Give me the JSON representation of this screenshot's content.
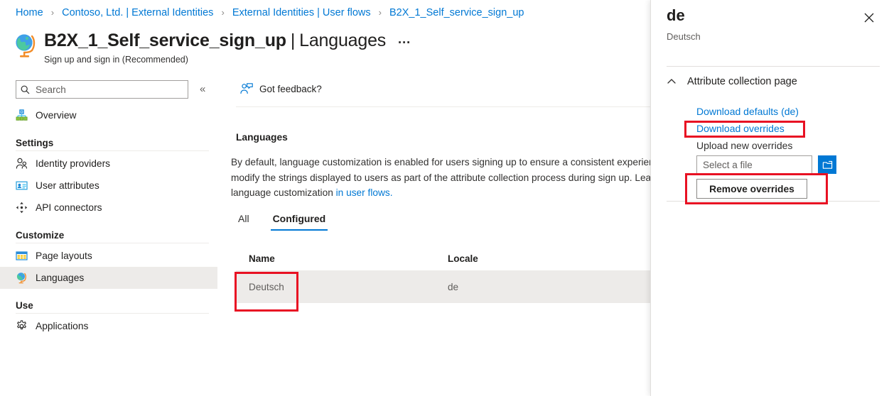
{
  "breadcrumb": {
    "items": [
      {
        "label": "Home"
      },
      {
        "label": "Contoso, Ltd. | External Identities"
      },
      {
        "label": "External Identities | User flows"
      },
      {
        "label": "B2X_1_Self_service_sign_up"
      }
    ],
    "separator": "›"
  },
  "header": {
    "title_main": "B2X_1_Self_service_sign_up",
    "title_sep": "|",
    "title_section": "Languages",
    "more_label": "…",
    "subtitle": "Sign up and sign in (Recommended)",
    "icon": "globe-icon"
  },
  "sidebar": {
    "search": {
      "placeholder": "Search",
      "value": "",
      "icon": "search-icon"
    },
    "collapse": {
      "label": "«",
      "icon": "chevron-double-left-icon"
    },
    "items": [
      {
        "label": "Overview",
        "icon": "hierarchy-icon",
        "selected": false
      },
      {
        "label": "Identity providers",
        "icon": "people-icon",
        "selected": false
      },
      {
        "label": "User attributes",
        "icon": "id-card-icon",
        "selected": false
      },
      {
        "label": "API connectors",
        "icon": "four-arrows-icon",
        "selected": false
      },
      {
        "label": "Page layouts",
        "icon": "table-icon",
        "selected": false
      },
      {
        "label": "Languages",
        "icon": "globe-icon",
        "selected": true
      },
      {
        "label": "Applications",
        "icon": "gear-icon",
        "selected": false
      }
    ],
    "sections": [
      {
        "label": "Settings"
      },
      {
        "label": "Customize"
      },
      {
        "label": "Use"
      }
    ]
  },
  "main": {
    "command_bar": {
      "feedback_label": "Got feedback?",
      "feedback_icon": "person-feedback-icon"
    },
    "section_title": "Languages",
    "description_text": "By default, language customization is enabled for users signing up to ensure a consistent experience. You can modify the strings displayed to users as part of the attribute collection process during sign up. Learn more about language customization",
    "description_link": "in user flows.",
    "tabs": [
      {
        "label": "All",
        "active": false
      },
      {
        "label": "Configured",
        "active": true
      }
    ],
    "table": {
      "columns": [
        "Name",
        "Locale"
      ],
      "rows": [
        {
          "name": "Deutsch",
          "locale": "de"
        }
      ]
    }
  },
  "panel": {
    "title": "de",
    "subtitle": "Deutsch",
    "close_label": "✕",
    "close_icon": "close-icon",
    "accordion": {
      "label": "Attribute collection page",
      "expanded": true,
      "icon": "chevron-up-icon"
    },
    "download_defaults_label": "Download defaults (de)",
    "download_overrides_label": "Download overrides",
    "upload_label": "Upload new overrides",
    "file_placeholder": "Select a file",
    "file_value": "",
    "browse_icon": "folder-browse-icon",
    "remove_label": "Remove overrides"
  },
  "colors": {
    "accent": "#0078d4",
    "annotation": "#e81123",
    "selected_row": "#edebe9",
    "text": "#201f1e"
  }
}
